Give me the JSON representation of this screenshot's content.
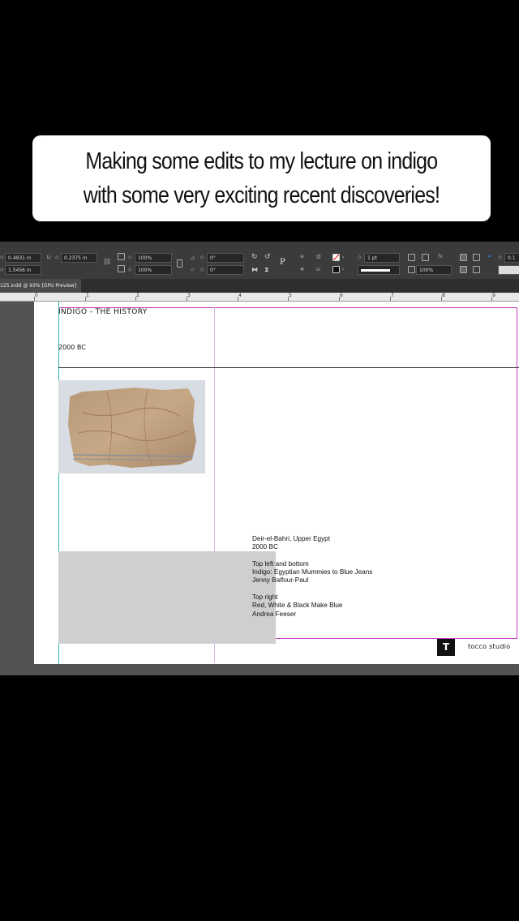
{
  "caption": {
    "line1": "Making some edits to my lecture on indigo",
    "line2": "with some very exciting recent discoveries!"
  },
  "control_panel": {
    "x_value": "0.4931 in",
    "y_value": "1.5456 in",
    "l_label": "L:",
    "l_value": "0.2375 in",
    "scale_x": "100%",
    "scale_y": "100%",
    "rotate": "0°",
    "shear": "0°",
    "stroke_weight": "1 pt",
    "opacity": "100%",
    "right_field": "0.1"
  },
  "document_tab": {
    "label": "125.indd @ 93% [GPU Preview]"
  },
  "ruler": {
    "ticks": [
      "0",
      "1",
      "2",
      "3",
      "4",
      "5",
      "6",
      "7",
      "8",
      "9"
    ]
  },
  "slide": {
    "heading": "INDIGO - THE HISTORY",
    "date": "2000 BC",
    "caption_lines": [
      {
        "text": "Deir-el-Bahri, Upper Egypt",
        "italic": true
      },
      {
        "text": "2000 BC",
        "italic": true
      },
      {
        "text": "",
        "italic": false
      },
      {
        "text": "Top left and bottom",
        "italic": true
      },
      {
        "text": "Indigo: Egyptian Mummies to Blue Jeans",
        "italic": true
      },
      {
        "text": "Jenny Balfour-Paul",
        "italic": false
      },
      {
        "text": "",
        "italic": false
      },
      {
        "text": "Top right",
        "italic": true
      },
      {
        "text": "Red, White & Black Make Blue",
        "italic": true
      },
      {
        "text": "Andrea Feeser",
        "italic": false
      }
    ],
    "logo_letter": "T",
    "brand": "tocco studio"
  },
  "colors": {
    "caption_bg": "#ffffff",
    "app_bg": "#535353",
    "margin_guide": "#c43bbf",
    "bleed_guide": "#27b5b5",
    "placeholder_gray": "#cfcfd0"
  }
}
